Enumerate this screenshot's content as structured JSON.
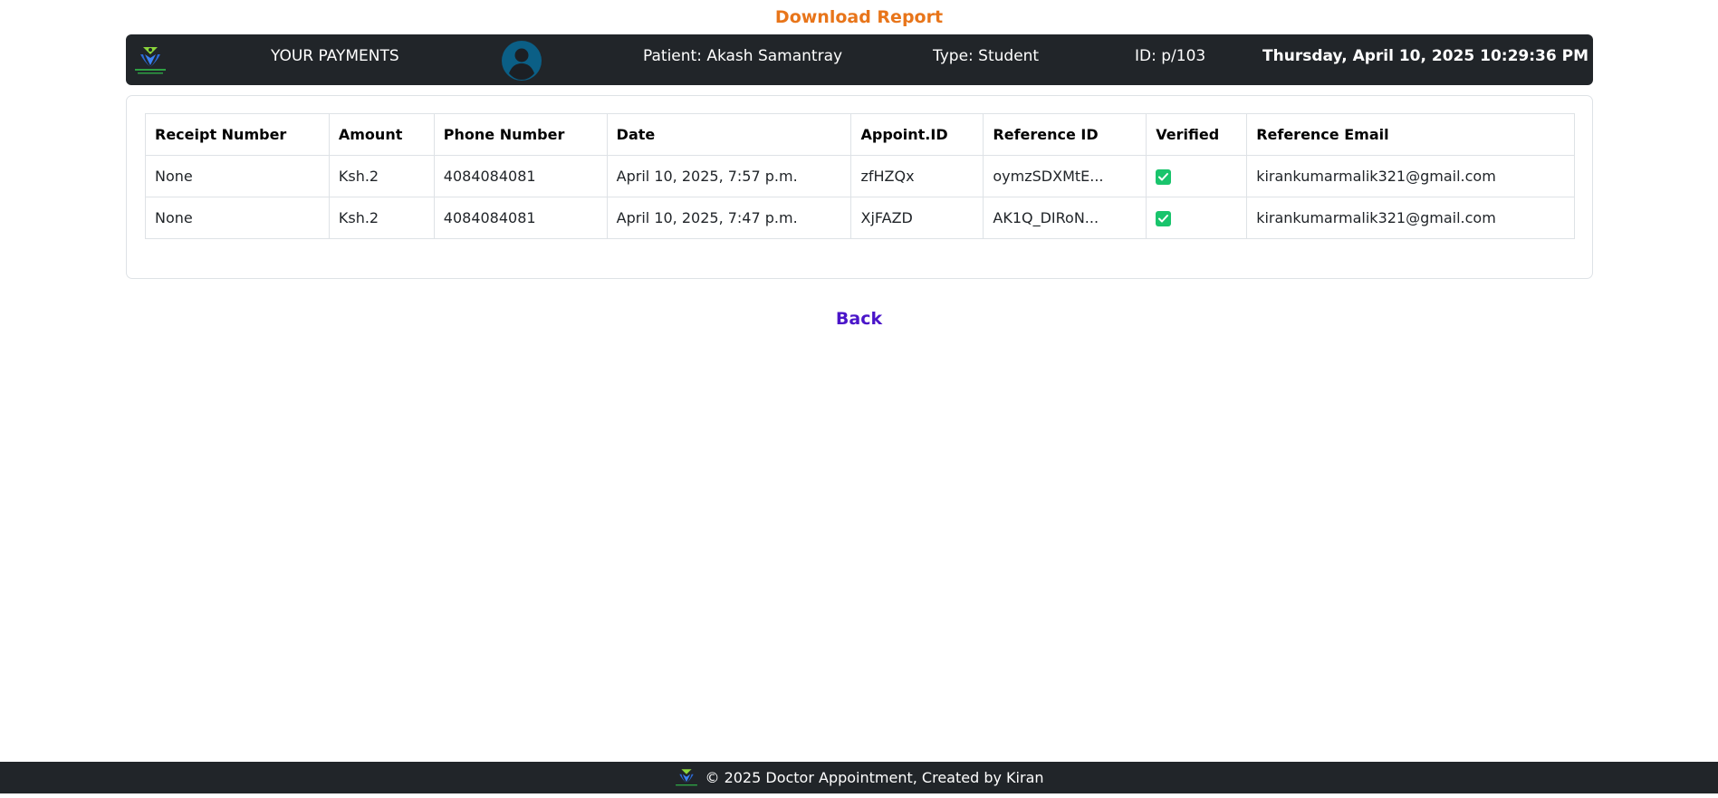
{
  "download_report_label": "Download Report",
  "header": {
    "title": "YOUR PAYMENTS",
    "patient": "Patient: Akash Samantray",
    "type": "Type: Student",
    "id": "ID: p/103",
    "datetime": "Thursday, April 10, 2025 10:29:36 PM"
  },
  "table": {
    "columns": [
      "Receipt Number",
      "Amount",
      "Phone Number",
      "Date",
      "Appoint.ID",
      "Reference ID",
      "Verified",
      "Reference Email"
    ],
    "rows": [
      {
        "receipt": "None",
        "amount": "Ksh.2",
        "phone": "4084084081",
        "date": "April 10, 2025, 7:57 p.m.",
        "appoint_id": "zfHZQx",
        "reference_id": "oymzSDXMtE...",
        "verified": true,
        "email": "kirankumarmalik321@gmail.com"
      },
      {
        "receipt": "None",
        "amount": "Ksh.2",
        "phone": "4084084081",
        "date": "April 10, 2025, 7:47 p.m.",
        "appoint_id": "XjFAZD",
        "reference_id": "AK1Q_DIRoN...",
        "verified": true,
        "email": "kirankumarmalik321@gmail.com"
      }
    ]
  },
  "back_label": "Back",
  "footer_text": "© 2025 Doctor Appointment, Created by Kiran",
  "colors": {
    "accent_orange": "#e8751a",
    "back_purple": "#4a15c9",
    "header_bg": "#212529",
    "verified_green": "#19c46c"
  }
}
